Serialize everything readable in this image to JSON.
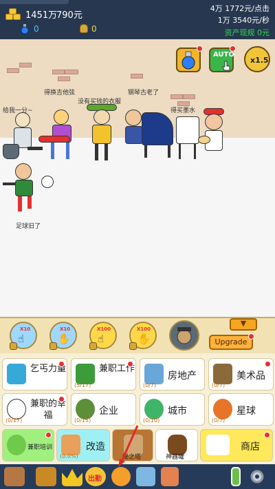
{
  "top_bar": {
    "money_total": "1451万",
    "money_cash": "790元",
    "potion_count": "0",
    "bag_count": "0",
    "rate_per_click": "4万 1772元/点击",
    "rate_per_second": "1万 3540元/秒",
    "asset_cash": "资产现规 0元"
  },
  "scene": {
    "auto_label": "AUTO",
    "speed_label": "x1.5",
    "captions": [
      "得换吉他弦",
      "没有买钱的衣服",
      "钢琴古老了",
      "得买墨水",
      "给我一分~",
      "足球旧了"
    ]
  },
  "controls": {
    "boost_buttons": [
      {
        "label": "X10",
        "icon": "tap-hand-icon",
        "style": "blue"
      },
      {
        "label": "X10",
        "icon": "thumbs-up-icon",
        "style": "blue"
      },
      {
        "label": "X100",
        "icon": "tap-hand-icon",
        "style": "yellow"
      },
      {
        "label": "X100",
        "icon": "thumbs-up-icon",
        "style": "yellow"
      }
    ],
    "upgrade_label": "Upgrade"
  },
  "grid": {
    "row1": [
      {
        "label": "乞丐力量",
        "icon": "beggar-bowl-icon",
        "count": "",
        "dot": true
      },
      {
        "label": "兼职工作",
        "icon": "parttime-worker-icon",
        "count": "(5/17)",
        "dot": true
      },
      {
        "label": "房地产",
        "icon": "building-icon",
        "count": "(0/7)",
        "dot": false
      },
      {
        "label": "美术品",
        "icon": "painting-icon",
        "count": "(0/7)",
        "dot": true
      }
    ],
    "row2": [
      {
        "label": "兼职的幸福",
        "icon": "soccer-ball-icon",
        "count": "(0/17)",
        "dot": true
      },
      {
        "label": "企业",
        "icon": "company-globe-icon",
        "count": "(0/15)",
        "dot": false
      },
      {
        "label": "城市",
        "icon": "globe-icon",
        "count": "(0/10)",
        "dot": false
      },
      {
        "label": "星球",
        "icon": "planet-icon",
        "count": "(0/7)",
        "dot": false
      }
    ],
    "row3": [
      {
        "label": "兼职培训",
        "icon": "alien-icon",
        "count": "",
        "dot": true
      },
      {
        "label": "改造",
        "icon": "house-icon",
        "count": "(0.0%)",
        "dot": false
      },
      {
        "label": "秘之塔",
        "icon": "locked-tower-icon",
        "count": "",
        "dot": false
      },
      {
        "label": "神器罐",
        "icon": "jar-icon",
        "count": "",
        "dot": false
      },
      {
        "label": "商店",
        "icon": "shop-cart-icon",
        "count": "",
        "dot": true
      }
    ]
  },
  "bottom_nav": [
    {
      "icon": "book-icon",
      "text": ""
    },
    {
      "icon": "treasure-chest-icon",
      "text": ""
    },
    {
      "icon": "crown-icon",
      "text": ""
    },
    {
      "icon": "sale-badge-icon",
      "text": "出勤"
    },
    {
      "icon": "medal-icon",
      "text": ""
    },
    {
      "icon": "winged-chest-icon",
      "text": ""
    },
    {
      "icon": "cards-icon",
      "text": ""
    },
    {
      "icon": "battery-icon",
      "text": ""
    },
    {
      "icon": "gear-icon",
      "text": ""
    }
  ]
}
